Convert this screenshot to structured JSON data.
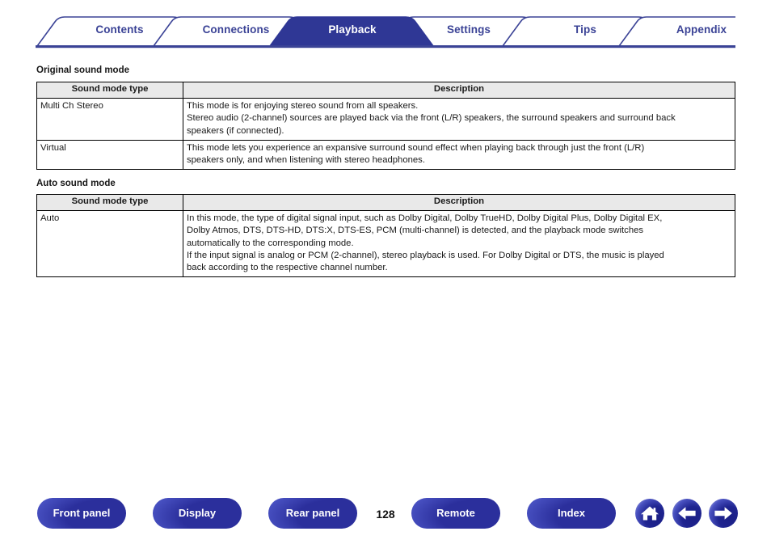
{
  "nav": {
    "tabs": [
      {
        "id": "contents",
        "label": "Contents",
        "active": false
      },
      {
        "id": "connections",
        "label": "Connections",
        "active": false
      },
      {
        "id": "playback",
        "label": "Playback",
        "active": true
      },
      {
        "id": "settings",
        "label": "Settings",
        "active": false
      },
      {
        "id": "tips",
        "label": "Tips",
        "active": false
      },
      {
        "id": "appendix",
        "label": "Appendix",
        "active": false
      }
    ],
    "accent_color": "#3b4396",
    "active_tab_bg": "#2f3795",
    "active_tab_text": "#ffffff"
  },
  "sections": [
    {
      "id": "original",
      "heading": "Original sound mode",
      "columns": {
        "type": "Sound mode type",
        "description": "Description"
      },
      "rows": [
        {
          "type": "Multi Ch Stereo",
          "description_lines": [
            "This mode is for enjoying stereo sound from all speakers.",
            "Stereo audio (2-channel) sources are played back via the front (L/R) speakers, the surround speakers and surround back",
            "speakers (if connected)."
          ]
        },
        {
          "type": "Virtual",
          "description_lines": [
            "This mode lets you experience an expansive surround sound effect when playing back through just the front (L/R)",
            "speakers only, and when listening with stereo headphones."
          ]
        }
      ]
    },
    {
      "id": "auto",
      "heading": "Auto sound mode",
      "columns": {
        "type": "Sound mode type",
        "description": "Description"
      },
      "rows": [
        {
          "type": "Auto",
          "description_lines": [
            "In this mode, the type of digital signal input, such as Dolby Digital, Dolby TrueHD, Dolby Digital Plus, Dolby Digital EX,",
            "Dolby Atmos, DTS, DTS-HD, DTS:X, DTS-ES, PCM (multi-channel) is detected, and the playback mode switches",
            "automatically to the corresponding mode.",
            "If the input signal is analog or PCM (2-channel), stereo playback is used. For Dolby Digital or DTS, the music is played",
            "back according to the respective channel number."
          ]
        }
      ]
    }
  ],
  "footer": {
    "buttons": [
      {
        "id": "front-panel",
        "label": "Front panel"
      },
      {
        "id": "display",
        "label": "Display"
      },
      {
        "id": "rear-panel",
        "label": "Rear panel"
      },
      {
        "id": "remote",
        "label": "Remote"
      },
      {
        "id": "index",
        "label": "Index"
      }
    ],
    "page_number": "128",
    "icons": [
      {
        "id": "home-icon",
        "name": "home-icon"
      },
      {
        "id": "arrow-left-icon",
        "name": "arrow-left-icon"
      },
      {
        "id": "arrow-right-icon",
        "name": "arrow-right-icon"
      }
    ],
    "button_color": "#2b2f9c"
  }
}
